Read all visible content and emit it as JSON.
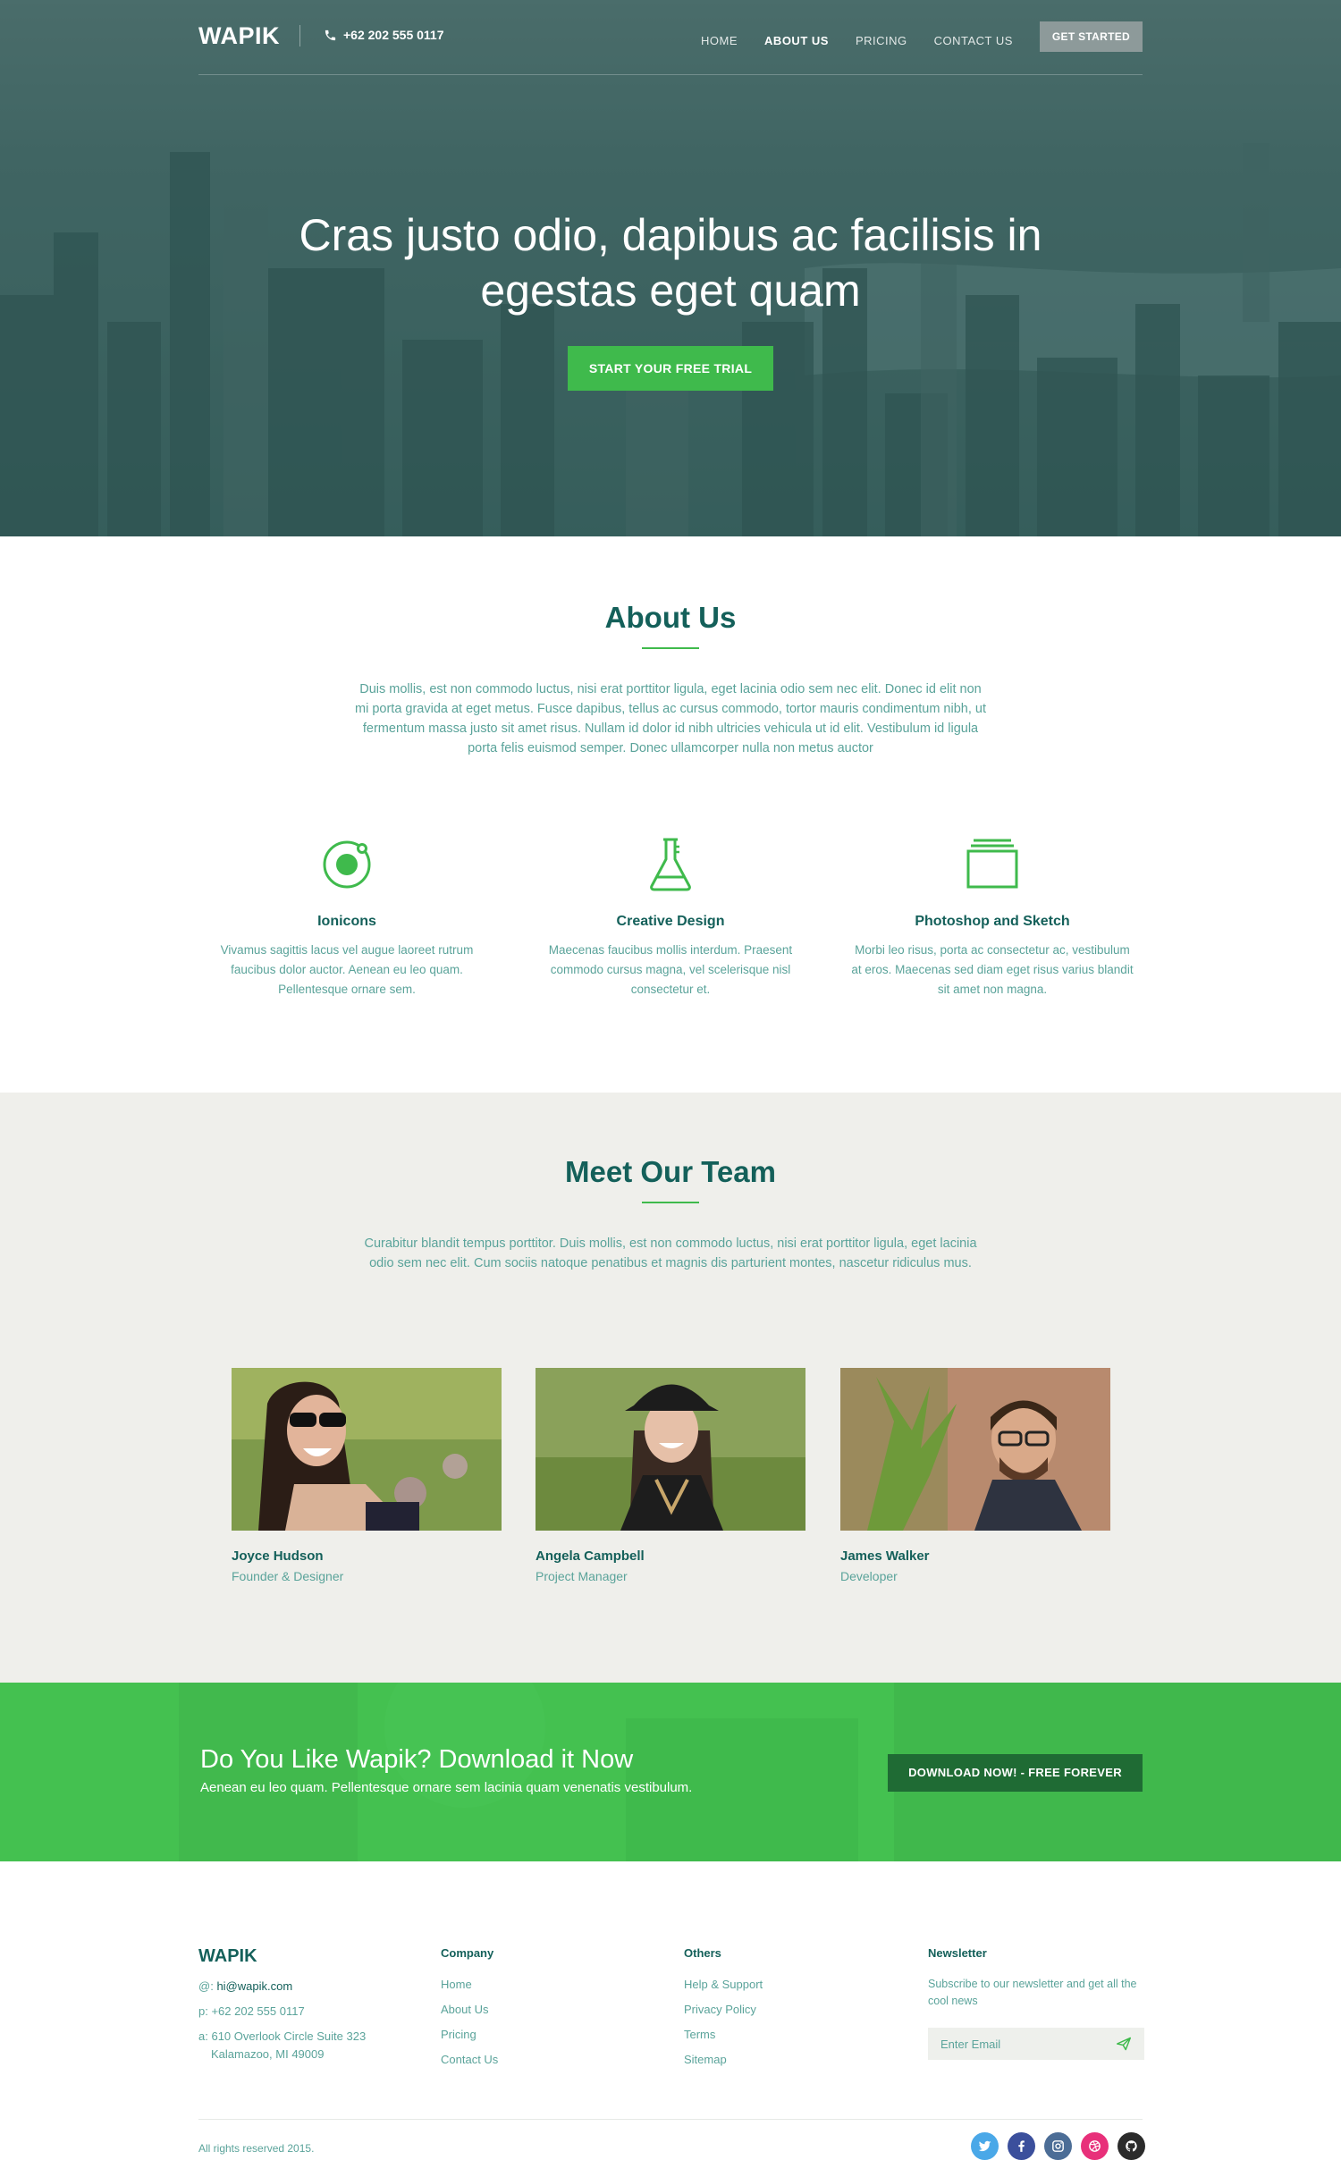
{
  "nav": {
    "logo": "WAPIK",
    "phone": "+62 202 555 0117",
    "menu": [
      "HOME",
      "ABOUT US",
      "PRICING",
      "CONTACT US"
    ],
    "active_index": 1,
    "cta": "GET STARTED"
  },
  "hero": {
    "title_line1": "Cras justo odio, dapibus ac facilisis in",
    "title_line2": "egestas eget quam",
    "button": "START YOUR FREE TRIAL"
  },
  "about": {
    "title": "About Us",
    "text": "Duis mollis, est non commodo luctus, nisi erat porttitor ligula, eget lacinia odio sem nec elit. Donec id elit non mi porta gravida at eget metus. Fusce dapibus, tellus ac cursus commodo, tortor mauris condimentum nibh, ut fermentum massa justo sit amet risus. Nullam id dolor id nibh ultricies vehicula ut id elit. Vestibulum id ligula porta felis euismod semper. Donec ullamcorper nulla non metus auctor",
    "features": [
      {
        "icon": "ionic-circle-icon",
        "title": "Ionicons",
        "text": "Vivamus sagittis lacus vel augue laoreet rutrum faucibus dolor auctor. Aenean eu leo quam. Pellentesque ornare sem."
      },
      {
        "icon": "flask-icon",
        "title": "Creative Design",
        "text": "Maecenas faucibus mollis interdum. Praesent commodo cursus magna, vel scelerisque nisl consectetur et."
      },
      {
        "icon": "layers-icon",
        "title": "Photoshop and Sketch",
        "text": "Morbi leo risus, porta ac consectetur ac, vestibulum at eros. Maecenas sed diam eget risus varius blandit sit amet non magna."
      }
    ]
  },
  "team": {
    "title": "Meet Our Team",
    "text": "Curabitur blandit tempus porttitor. Duis mollis, est non commodo luctus, nisi erat porttitor ligula, eget lacinia odio sem nec elit. Cum sociis natoque penatibus et magnis dis parturient montes, nascetur ridiculus mus.",
    "members": [
      {
        "name": "Joyce Hudson",
        "role": "Founder & Designer"
      },
      {
        "name": "Angela Campbell",
        "role": "Project Manager"
      },
      {
        "name": "James Walker",
        "role": "Developer"
      }
    ]
  },
  "cta": {
    "title": "Do You Like Wapik? Download it Now",
    "subtitle": "Aenean eu leo quam. Pellentesque ornare sem lacinia quam venenatis vestibulum.",
    "button": "DOWNLOAD NOW! - FREE FOREVER"
  },
  "footer": {
    "logo": "WAPIK",
    "email_prefix": "@:",
    "email": "hi@wapik.com",
    "phone_prefix": "p:",
    "phone": "+62 202 555 0117",
    "address_prefix": "a:",
    "address_line1": "610 Overlook Circle Suite 323",
    "address_line2": "Kalamazoo, MI 49009",
    "company_title": "Company",
    "company_links": [
      "Home",
      "About Us",
      "Pricing",
      "Contact Us"
    ],
    "others_title": "Others",
    "others_links": [
      "Help & Support",
      "Privacy Policy",
      "Terms",
      "Sitemap"
    ],
    "newsletter_title": "Newsletter",
    "newsletter_text": "Subscribe to our newsletter and get all the cool news",
    "email_placeholder": "Enter Email",
    "copyright": "All rights reserved 2015.",
    "socials": [
      {
        "icon": "twitter-icon",
        "color": "#4aa8e8"
      },
      {
        "icon": "facebook-icon",
        "color": "#3b4f9c"
      },
      {
        "icon": "instagram-icon",
        "color": "#4c6d96"
      },
      {
        "icon": "dribbble-icon",
        "color": "#e8307a"
      },
      {
        "icon": "github-icon",
        "color": "#2b2b2b"
      }
    ]
  },
  "colors": {
    "accent": "#3fba4c",
    "heading": "#14605a",
    "text": "#5aa39a",
    "dark_button": "#1f6b34"
  }
}
